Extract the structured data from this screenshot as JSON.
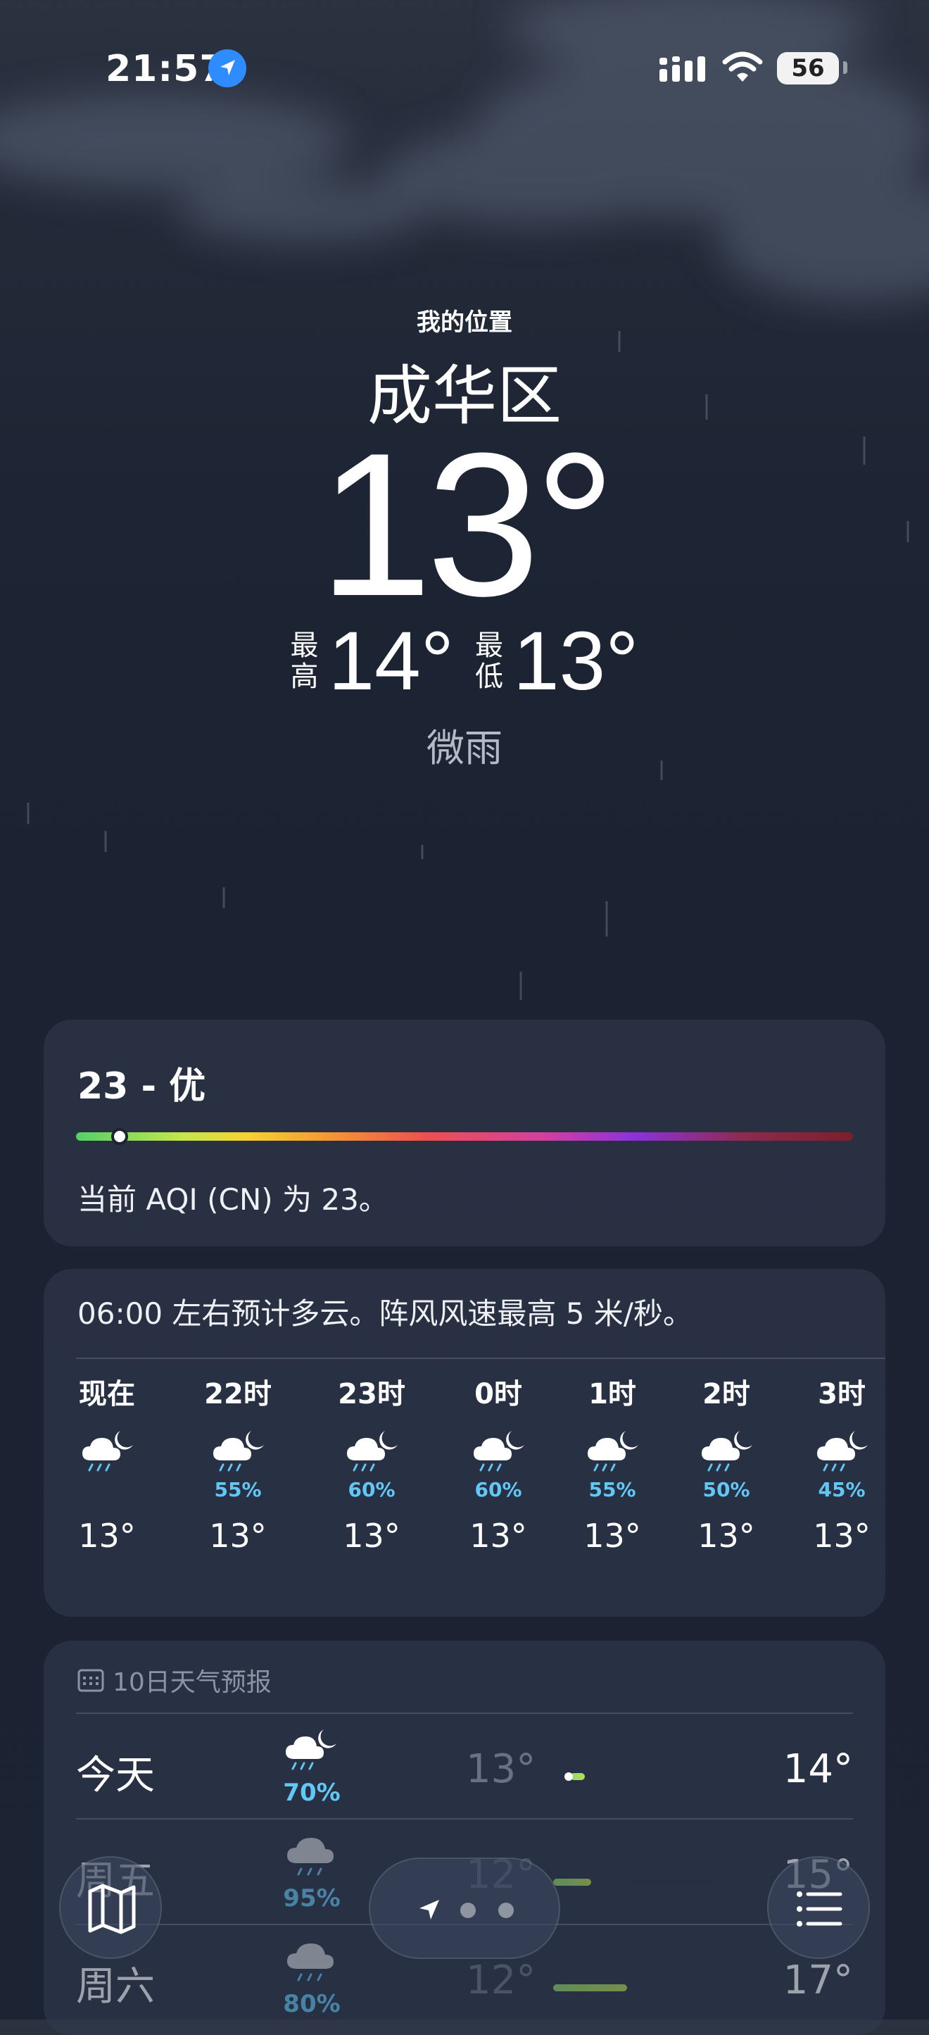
{
  "status_bar": {
    "time": "21:57",
    "battery": "56"
  },
  "header": {
    "my_location": "我的位置",
    "city": "成华区",
    "temperature": "13°",
    "high_label": "最高",
    "high": "14°",
    "low_label": "最低",
    "low": "13°",
    "condition": "微雨"
  },
  "aqi": {
    "title": "23 - 优",
    "description": "当前 AQI (CN) 为 23。",
    "value": 23
  },
  "hourly": {
    "summary": "06:00 左右预计多云。阵风风速最高 5 米/秒。",
    "hours": [
      {
        "label": "现在",
        "icon": "moon-rain-icon",
        "pct": "",
        "temp": "13°"
      },
      {
        "label": "22时",
        "icon": "moon-rain-icon",
        "pct": "55%",
        "temp": "13°"
      },
      {
        "label": "23时",
        "icon": "moon-rain-icon",
        "pct": "60%",
        "temp": "13°"
      },
      {
        "label": "0时",
        "icon": "moon-rain-icon",
        "pct": "60%",
        "temp": "13°"
      },
      {
        "label": "1时",
        "icon": "moon-rain-icon",
        "pct": "55%",
        "temp": "13°"
      },
      {
        "label": "2时",
        "icon": "moon-rain-icon",
        "pct": "50%",
        "temp": "13°"
      },
      {
        "label": "3时",
        "icon": "moon-rain-icon",
        "pct": "45%",
        "temp": "13°"
      }
    ]
  },
  "daily": {
    "header": "10日天气预报",
    "days": [
      {
        "name": "今天",
        "icon": "moon-rain-icon",
        "pct": "70%",
        "low": "13°",
        "high": "14°"
      },
      {
        "name": "周五",
        "icon": "cloud-rain-icon",
        "pct": "95%",
        "low": "12°",
        "high": "15°"
      },
      {
        "name": "周六",
        "icon": "cloud-rain-icon",
        "pct": "80%",
        "low": "12°",
        "high": "17°"
      }
    ]
  },
  "colors": {
    "accent_blue": "#63c7f5",
    "location_blue": "#2f8cff"
  }
}
